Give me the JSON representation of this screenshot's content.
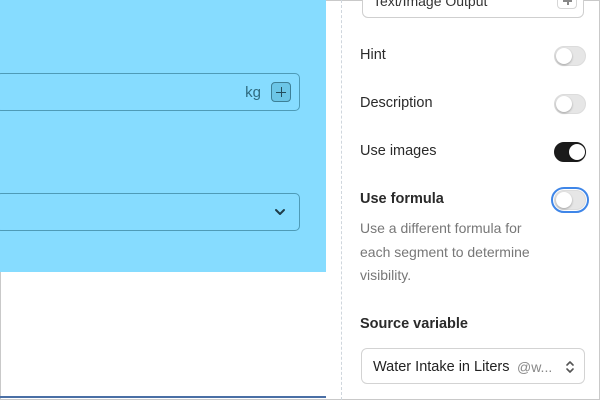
{
  "canvas": {
    "unit_label": "kg"
  },
  "panel": {
    "top_input_value": "Text/Image Output",
    "toggles": [
      {
        "label": "Hint",
        "state": "off"
      },
      {
        "label": "Description",
        "state": "off"
      },
      {
        "label": "Use images",
        "state": "on"
      },
      {
        "label": "Use formula",
        "state": "off"
      }
    ],
    "formula_description": "Use a different formula for each segment to determine visibility.",
    "source_variable": {
      "label": "Source variable",
      "value": "Water Intake in Liters",
      "hint": "@w..."
    }
  },
  "colors": {
    "canvas_bg": "#86dcff",
    "toggle_on": "#1b1b1b",
    "focus": "#3f86e8"
  },
  "icons": {
    "unit_add": "plus-icon",
    "select_chevron": "chevron-down-icon",
    "top_add": "plus-icon",
    "select_updown": "chevron-updown-icon"
  }
}
